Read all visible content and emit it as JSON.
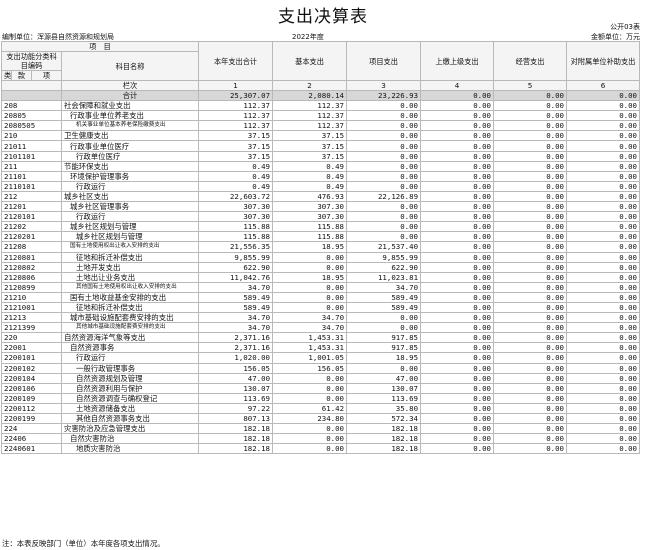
{
  "header": {
    "title": "支出决算表",
    "form_no": "公开03表",
    "org": "编制单位：浑源县自然资源和规划局",
    "year": "2022年度",
    "unit": "金额单位：万元"
  },
  "columns": {
    "item_group": "项　目",
    "func_code": "支出功能分类科目编码",
    "name": "科目名称",
    "total": "本年支出合计",
    "basic": "基本支出",
    "project": "项目支出",
    "upper": "上缴上级支出",
    "business": "经营支出",
    "subsidy": "对附属单位补助支出",
    "lei": "类",
    "kuan": "款",
    "xiang": "项",
    "lanci": "栏次",
    "c1": "1",
    "c2": "2",
    "c3": "3",
    "c4": "4",
    "c5": "5",
    "c6": "6"
  },
  "total_row": {
    "name": "合计",
    "v1": "25,307.07",
    "v2": "2,080.14",
    "v3": "23,226.93",
    "v4": "0.00",
    "v5": "0.00",
    "v6": "0.00"
  },
  "rows": [
    {
      "code": "208",
      "name": "社会保障和就业支出",
      "v1": "112.37",
      "v2": "112.37",
      "v3": "0.00",
      "v4": "0.00",
      "v5": "0.00",
      "v6": "0.00"
    },
    {
      "code": "20805",
      "name": "行政事业单位养老支出",
      "v1": "112.37",
      "v2": "112.37",
      "v3": "0.00",
      "v4": "0.00",
      "v5": "0.00",
      "v6": "0.00"
    },
    {
      "code": "2080505",
      "name": "机关事业单位基本养老保险缴费支出",
      "v1": "112.37",
      "v2": "112.37",
      "v3": "0.00",
      "v4": "0.00",
      "v5": "0.00",
      "v6": "0.00"
    },
    {
      "code": "210",
      "name": "卫生健康支出",
      "v1": "37.15",
      "v2": "37.15",
      "v3": "0.00",
      "v4": "0.00",
      "v5": "0.00",
      "v6": "0.00"
    },
    {
      "code": "21011",
      "name": "行政事业单位医疗",
      "v1": "37.15",
      "v2": "37.15",
      "v3": "0.00",
      "v4": "0.00",
      "v5": "0.00",
      "v6": "0.00"
    },
    {
      "code": "2101101",
      "name": "行政单位医疗",
      "v1": "37.15",
      "v2": "37.15",
      "v3": "0.00",
      "v4": "0.00",
      "v5": "0.00",
      "v6": "0.00"
    },
    {
      "code": "211",
      "name": "节能环保支出",
      "v1": "0.49",
      "v2": "0.49",
      "v3": "0.00",
      "v4": "0.00",
      "v5": "0.00",
      "v6": "0.00"
    },
    {
      "code": "21101",
      "name": "环境保护管理事务",
      "v1": "0.49",
      "v2": "0.49",
      "v3": "0.00",
      "v4": "0.00",
      "v5": "0.00",
      "v6": "0.00"
    },
    {
      "code": "2110101",
      "name": "行政运行",
      "v1": "0.49",
      "v2": "0.49",
      "v3": "0.00",
      "v4": "0.00",
      "v5": "0.00",
      "v6": "0.00"
    },
    {
      "code": "212",
      "name": "城乡社区支出",
      "v1": "22,603.72",
      "v2": "476.93",
      "v3": "22,126.89",
      "v4": "0.00",
      "v5": "0.00",
      "v6": "0.00"
    },
    {
      "code": "21201",
      "name": "城乡社区管理事务",
      "v1": "307.30",
      "v2": "307.30",
      "v3": "0.00",
      "v4": "0.00",
      "v5": "0.00",
      "v6": "0.00"
    },
    {
      "code": "2120101",
      "name": "行政运行",
      "v1": "307.30",
      "v2": "307.30",
      "v3": "0.00",
      "v4": "0.00",
      "v5": "0.00",
      "v6": "0.00"
    },
    {
      "code": "21202",
      "name": "城乡社区规划与管理",
      "v1": "115.88",
      "v2": "115.88",
      "v3": "0.00",
      "v4": "0.00",
      "v5": "0.00",
      "v6": "0.00"
    },
    {
      "code": "2120201",
      "name": "城乡社区规划与管理",
      "v1": "115.88",
      "v2": "115.88",
      "v3": "0.00",
      "v4": "0.00",
      "v5": "0.00",
      "v6": "0.00"
    },
    {
      "code": "21208",
      "name": "国有土地使用权出让收入安排的支出",
      "v1": "21,556.35",
      "v2": "18.95",
      "v3": "21,537.40",
      "v4": "0.00",
      "v5": "0.00",
      "v6": "0.00"
    },
    {
      "code": "2120801",
      "name": "征地和拆迁补偿支出",
      "v1": "9,855.99",
      "v2": "0.00",
      "v3": "9,855.99",
      "v4": "0.00",
      "v5": "0.00",
      "v6": "0.00"
    },
    {
      "code": "2120802",
      "name": "土地开发支出",
      "v1": "622.90",
      "v2": "0.00",
      "v3": "622.90",
      "v4": "0.00",
      "v5": "0.00",
      "v6": "0.00"
    },
    {
      "code": "2120806",
      "name": "土地出让业务支出",
      "v1": "11,042.76",
      "v2": "18.95",
      "v3": "11,023.81",
      "v4": "0.00",
      "v5": "0.00",
      "v6": "0.00"
    },
    {
      "code": "2120899",
      "name": "其他国有土地使用权出让收入安排的支出",
      "v1": "34.70",
      "v2": "0.00",
      "v3": "34.70",
      "v4": "0.00",
      "v5": "0.00",
      "v6": "0.00"
    },
    {
      "code": "21210",
      "name": "国有土地收益基金安排的支出",
      "v1": "589.49",
      "v2": "0.00",
      "v3": "589.49",
      "v4": "0.00",
      "v5": "0.00",
      "v6": "0.00"
    },
    {
      "code": "2121001",
      "name": "征地和拆迁补偿支出",
      "v1": "589.49",
      "v2": "0.00",
      "v3": "589.49",
      "v4": "0.00",
      "v5": "0.00",
      "v6": "0.00"
    },
    {
      "code": "21213",
      "name": "城市基础设施配套费安排的支出",
      "v1": "34.70",
      "v2": "34.70",
      "v3": "0.00",
      "v4": "0.00",
      "v5": "0.00",
      "v6": "0.00"
    },
    {
      "code": "2121399",
      "name": "其他城市基础设施配套费安排的支出",
      "v1": "34.70",
      "v2": "34.70",
      "v3": "0.00",
      "v4": "0.00",
      "v5": "0.00",
      "v6": "0.00"
    },
    {
      "code": "220",
      "name": "自然资源海洋气象等支出",
      "v1": "2,371.16",
      "v2": "1,453.31",
      "v3": "917.85",
      "v4": "0.00",
      "v5": "0.00",
      "v6": "0.00"
    },
    {
      "code": "22001",
      "name": "自然资源事务",
      "v1": "2,371.16",
      "v2": "1,453.31",
      "v3": "917.85",
      "v4": "0.00",
      "v5": "0.00",
      "v6": "0.00"
    },
    {
      "code": "2200101",
      "name": "行政运行",
      "v1": "1,020.00",
      "v2": "1,001.05",
      "v3": "18.95",
      "v4": "0.00",
      "v5": "0.00",
      "v6": "0.00"
    },
    {
      "code": "2200102",
      "name": "一般行政管理事务",
      "v1": "156.05",
      "v2": "156.05",
      "v3": "0.00",
      "v4": "0.00",
      "v5": "0.00",
      "v6": "0.00"
    },
    {
      "code": "2200104",
      "name": "自然资源规划及管理",
      "v1": "47.00",
      "v2": "0.00",
      "v3": "47.00",
      "v4": "0.00",
      "v5": "0.00",
      "v6": "0.00"
    },
    {
      "code": "2200106",
      "name": "自然资源利用与保护",
      "v1": "130.07",
      "v2": "0.00",
      "v3": "130.07",
      "v4": "0.00",
      "v5": "0.00",
      "v6": "0.00"
    },
    {
      "code": "2200109",
      "name": "自然资源调查与确权登记",
      "v1": "113.69",
      "v2": "0.00",
      "v3": "113.69",
      "v4": "0.00",
      "v5": "0.00",
      "v6": "0.00"
    },
    {
      "code": "2200112",
      "name": "土地资源储备支出",
      "v1": "97.22",
      "v2": "61.42",
      "v3": "35.80",
      "v4": "0.00",
      "v5": "0.00",
      "v6": "0.00"
    },
    {
      "code": "2200199",
      "name": "其他自然资源事务支出",
      "v1": "807.13",
      "v2": "234.80",
      "v3": "572.34",
      "v4": "0.00",
      "v5": "0.00",
      "v6": "0.00"
    },
    {
      "code": "224",
      "name": "灾害防治及应急管理支出",
      "v1": "182.18",
      "v2": "0.00",
      "v3": "182.18",
      "v4": "0.00",
      "v5": "0.00",
      "v6": "0.00"
    },
    {
      "code": "22406",
      "name": "自然灾害防治",
      "v1": "182.18",
      "v2": "0.00",
      "v3": "182.18",
      "v4": "0.00",
      "v5": "0.00",
      "v6": "0.00"
    },
    {
      "code": "2240601",
      "name": "地质灾害防治",
      "v1": "182.18",
      "v2": "0.00",
      "v3": "182.18",
      "v4": "0.00",
      "v5": "0.00",
      "v6": "0.00"
    }
  ],
  "note": "注：本表反映部门（单位）本年度各项支出情况。"
}
